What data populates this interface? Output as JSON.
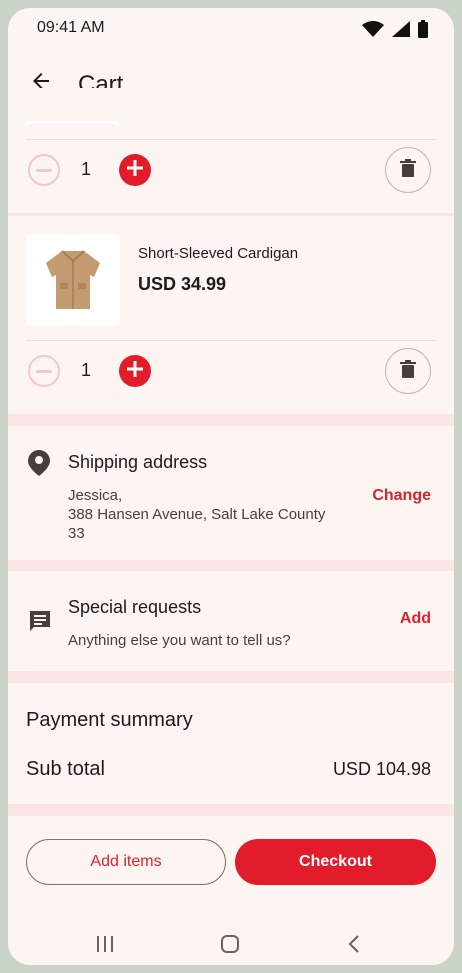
{
  "status": {
    "time": "09:41 AM"
  },
  "header": {
    "title": "Cart"
  },
  "items": [
    {
      "quantity": "1"
    },
    {
      "name": "Short-Sleeved Cardigan",
      "price": "USD 34.99",
      "quantity": "1"
    }
  ],
  "shipping": {
    "title": "Shipping address",
    "name": "Jessica,",
    "line1": "388 Hansen Avenue, Salt Lake County",
    "line2": "33",
    "action": "Change"
  },
  "requests": {
    "title": "Special requests",
    "subtitle": "Anything else you want to tell us?",
    "action": "Add"
  },
  "payment": {
    "title": "Payment summary",
    "subtotal_label": "Sub total",
    "subtotal_value": "USD 104.98"
  },
  "actions": {
    "add_items": "Add items",
    "checkout": "Checkout"
  },
  "colors": {
    "accent": "#e31c2b",
    "background": "#fdf5f2"
  },
  "icons": [
    "wifi-icon",
    "signal-icon",
    "battery-icon",
    "back-arrow-icon",
    "minus-icon",
    "plus-icon",
    "trash-icon",
    "location-pin-icon",
    "chat-icon",
    "recents-nav-icon",
    "home-nav-icon",
    "back-nav-icon"
  ]
}
